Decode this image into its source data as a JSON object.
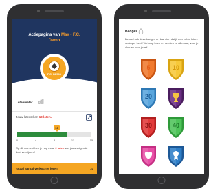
{
  "left_screen": {
    "header": {
      "title_prefix": "Actiepagina van",
      "club_name": "Max - F.C.",
      "title_line2": "Demo",
      "badge_text": "F.C. DEMO"
    },
    "lotenmeter": {
      "label": "Lotenmeter"
    },
    "jouw": {
      "prefix": "Jouw lotenteller: ",
      "value": "10 loten."
    },
    "progress": {
      "current_label": "10",
      "current": 10,
      "max": 15,
      "ticks": [
        "0",
        "4",
        "8",
        "11",
        "15"
      ]
    },
    "info": {
      "prefix": "Op dit moment ben je nog maar ",
      "highlight": "2 loten",
      "suffix": " van jouw volgende doel verwijderd!"
    },
    "footer": {
      "label": "Totaal aantal verkochte loten",
      "value": "10"
    }
  },
  "right_screen": {
    "title": "Badges",
    "text": "Behaal ook deze badges en laat zien dat jij een echte loten-verkoper bent! Verkoop loten en verdien ze allemaal, voor je club en voor jezelf.",
    "badges": [
      {
        "label": "5",
        "color": "#f07a2f",
        "rim": "#c85412",
        "text_color": "#e45d1a"
      },
      {
        "label": "10",
        "color": "#f7c93a",
        "rim": "#d9a412",
        "text_color": "#d69a0c"
      },
      {
        "label": "20",
        "color": "#5aa6dd",
        "rim": "#2e78b4",
        "text_color": "#1f5f99"
      },
      {
        "label": "",
        "color": "#6b2f84",
        "rim": "#4a1d5e",
        "text_color": "#ffffff",
        "icon": "trophy-icon"
      },
      {
        "label": "30",
        "color": "#e23a3a",
        "rim": "#b21f1f",
        "text_color": "#8e1414"
      },
      {
        "label": "40",
        "color": "#4fc45a",
        "rim": "#2f9a3a",
        "text_color": "#1f7a2a"
      },
      {
        "label": "",
        "color": "#e84fa6",
        "rim": "#c42f83",
        "text_color": "#ffffff",
        "icon": "heart-icon"
      },
      {
        "label": "",
        "color": "#2f7fc8",
        "rim": "#1d5896",
        "text_color": "#ffffff",
        "icon": "ribbon-icon"
      }
    ]
  }
}
